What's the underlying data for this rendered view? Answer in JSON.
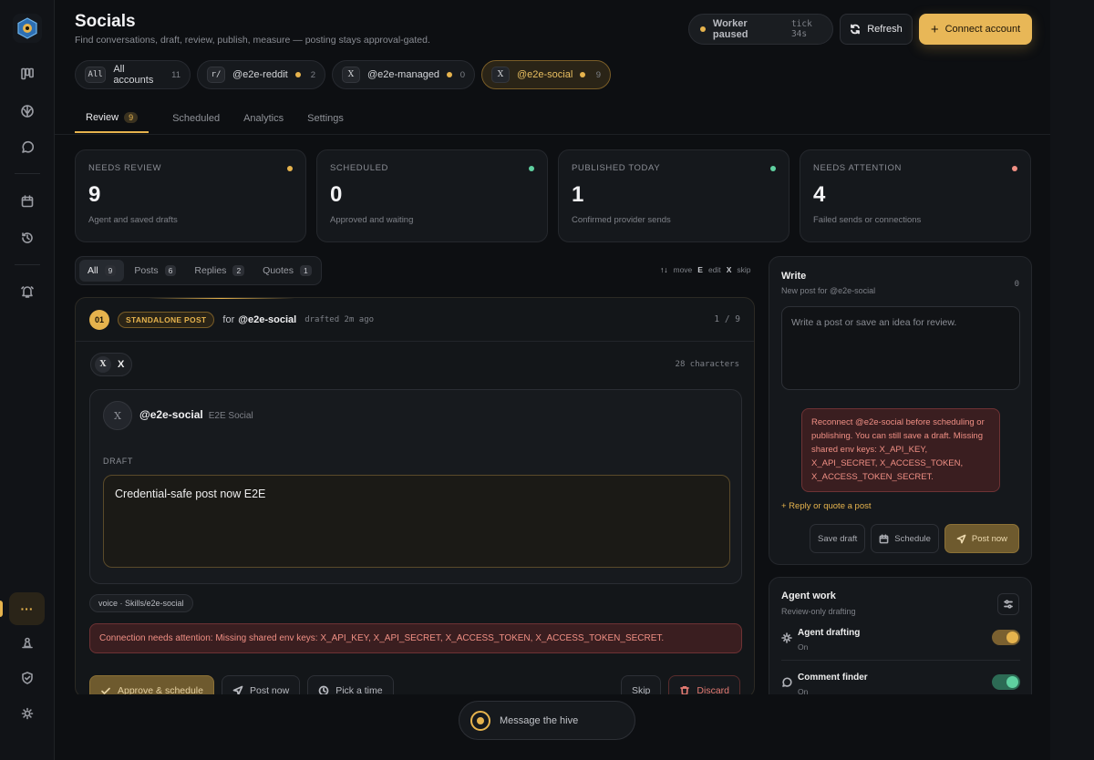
{
  "header": {
    "title": "Socials",
    "subtitle": "Find conversations, draft, review, publish, measure — posting stays approval-gated.",
    "worker_status": "Worker paused",
    "worker_tick": "tick 34s",
    "refresh_label": "Refresh",
    "connect_label": "Connect account"
  },
  "accounts": [
    {
      "badge": "All",
      "label": "All accounts",
      "count": "11"
    },
    {
      "badge": "r/",
      "label": "@e2e-reddit",
      "count": "2"
    },
    {
      "badge": "X",
      "label": "@e2e-managed",
      "count": "0"
    },
    {
      "badge": "X",
      "label": "@e2e-social",
      "count": "9"
    }
  ],
  "tabs": [
    {
      "label": "Review",
      "count": "9"
    },
    {
      "label": "Scheduled"
    },
    {
      "label": "Analytics"
    },
    {
      "label": "Settings"
    }
  ],
  "stats": [
    {
      "label": "NEEDS REVIEW",
      "value": "9",
      "sub": "Agent and saved drafts",
      "color": "#e6b34d"
    },
    {
      "label": "SCHEDULED",
      "value": "0",
      "sub": "Approved and waiting",
      "color": "#5fd0a0"
    },
    {
      "label": "PUBLISHED TODAY",
      "value": "1",
      "sub": "Confirmed provider sends",
      "color": "#5fd0a0"
    },
    {
      "label": "NEEDS ATTENTION",
      "value": "4",
      "sub": "Failed sends or connections",
      "color": "#f08f84"
    }
  ],
  "filters": [
    {
      "label": "All",
      "count": "9"
    },
    {
      "label": "Posts",
      "count": "6"
    },
    {
      "label": "Replies",
      "count": "2"
    },
    {
      "label": "Quotes",
      "count": "1"
    }
  ],
  "shortcuts": {
    "move_key": "↑↓",
    "move": "move",
    "edit_key": "E",
    "edit": "edit",
    "skip_key": "X",
    "skip": "skip"
  },
  "card": {
    "index": "01",
    "type": "STANDALONE POST",
    "for_prefix": "for",
    "for_account": "@e2e-social",
    "drafted": "drafted 2m ago",
    "position": "1 / 9",
    "platform": "X",
    "char_count": "28 characters",
    "handle": "@e2e-social",
    "display_name": "E2E Social",
    "draft_label": "DRAFT",
    "draft_text": "Credential-safe post now E2E",
    "voice": "voice · Skills/e2e-social",
    "warning": "Connection needs attention: Missing shared env keys: X_API_KEY, X_API_SECRET, X_ACCESS_TOKEN, X_ACCESS_TOKEN_SECRET.",
    "approve_label": "Approve & schedule",
    "post_now_label": "Post now",
    "pick_time_label": "Pick a time",
    "skip_label": "Skip",
    "discard_label": "Discard"
  },
  "write": {
    "title": "Write",
    "subtitle": "New post for @e2e-social",
    "count": "0",
    "placeholder": "Write a post or save an idea for review.",
    "warning": "Reconnect @e2e-social before scheduling or publishing. You can still save a draft. Missing shared env keys: X_API_KEY, X_API_SECRET, X_ACCESS_TOKEN, X_ACCESS_TOKEN_SECRET.",
    "reply_link": "+ Reply or quote a post",
    "save_label": "Save draft",
    "schedule_label": "Schedule",
    "post_label": "Post now"
  },
  "agent": {
    "title": "Agent work",
    "subtitle": "Review-only drafting",
    "items": [
      {
        "name": "Agent drafting",
        "state": "On",
        "color": "#e6b34d"
      },
      {
        "name": "Comment finder",
        "state": "On",
        "color": "#5fd0a0"
      }
    ]
  },
  "composer": {
    "placeholder": "Message the hive"
  },
  "colors": {
    "accent": "#e6b34d",
    "success": "#5fd0a0",
    "danger": "#f08f84"
  }
}
